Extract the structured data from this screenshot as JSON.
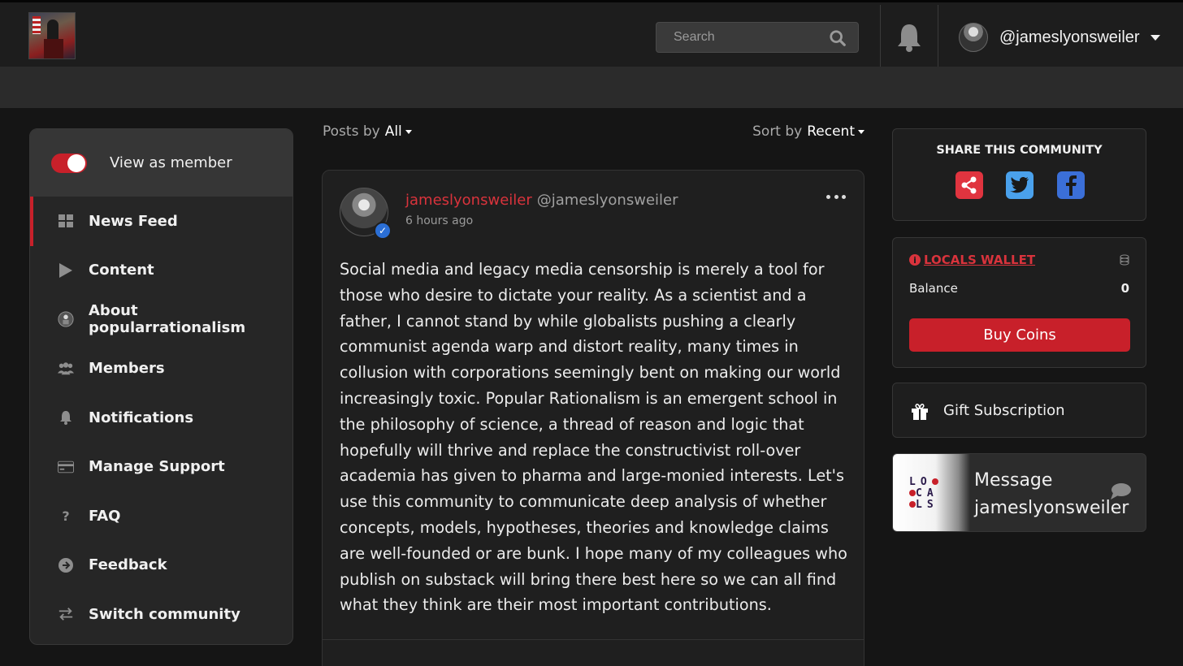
{
  "header": {
    "logo_alt": "community logo",
    "search": {
      "placeholder": "Search"
    },
    "user": {
      "handle": "@jameslyonsweiler"
    }
  },
  "sidebar": {
    "view_as_member": "View as member",
    "items": [
      {
        "label": "News Feed",
        "icon": "grid-icon",
        "active": true
      },
      {
        "label": "Content",
        "icon": "play-icon"
      },
      {
        "label": "About popularrationalism",
        "icon": "community-avatar"
      },
      {
        "label": "Members",
        "icon": "users-icon"
      },
      {
        "label": "Notifications",
        "icon": "bell-icon"
      },
      {
        "label": "Manage Support",
        "icon": "card-icon"
      },
      {
        "label": "FAQ",
        "icon": "question-icon"
      },
      {
        "label": "Feedback",
        "icon": "arrow-circle-icon"
      },
      {
        "label": "Switch community",
        "icon": "switch-icon"
      }
    ]
  },
  "feed": {
    "posts_by_label": "Posts by",
    "posts_by_value": "All",
    "sort_by_label": "Sort by",
    "sort_by_value": "Recent",
    "post": {
      "display_name": "jameslyonsweiler",
      "handle": "@jameslyonsweiler",
      "time": "6 hours ago",
      "body": "Social media and legacy media censorship is merely a tool for those who desire to dictate your reality. As a scientist and a father, I cannot stand by while globalists pushing a clearly communist agenda warp and distort reality, many times in collusion with corporations seemingly bent on making our world increasingly toxic. Popular Rationalism is an emergent school in the philosophy of science, a thread of reason and logic that hopefully will thrive and replace the constructivist roll-over academia has given to pharma and large-monied interests. Let's use this community to communicate deep analysis of whether concepts, models, hypotheses, theories and knowledge claims are well-founded or are bunk. I hope many of my colleagues who publish on substack will bring there best here so we can all find what they think are their most important contributions."
    }
  },
  "right": {
    "share_title": "SHARE THIS COMMUNITY",
    "wallet_title": "LOCALS WALLET",
    "balance_label": "Balance",
    "balance_value": "0",
    "buy_coins": "Buy Coins",
    "gift_subscription": "Gift Subscription",
    "message_line1": "Message",
    "message_line2": "jameslyonsweiler",
    "locals_logo_text": "LOCALS"
  },
  "colors": {
    "accent": "#c8202a",
    "background": "#151515",
    "twitter": "#4aa1ec",
    "facebook": "#3b6fd8"
  }
}
